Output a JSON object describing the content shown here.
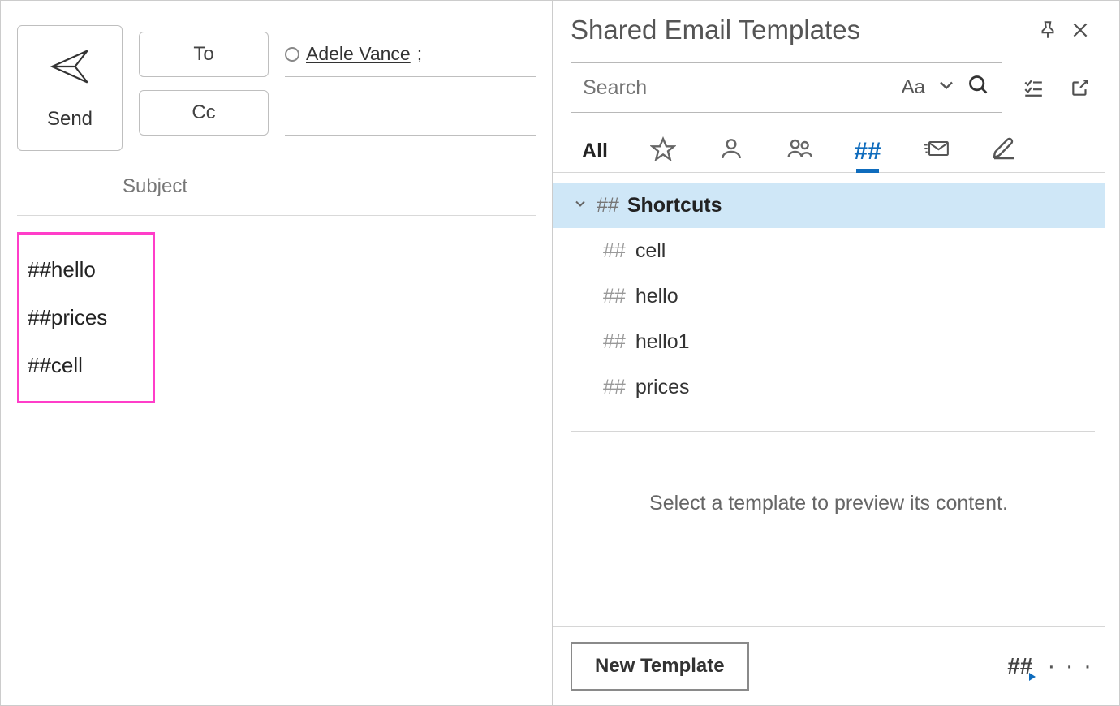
{
  "compose": {
    "send_label": "Send",
    "to_label": "To",
    "cc_label": "Cc",
    "subject_label": "Subject",
    "recipient": "Adele Vance",
    "recipient_suffix": ";",
    "body_shortcuts": [
      "##hello",
      "##prices",
      "##cell"
    ]
  },
  "templates": {
    "title": "Shared Email Templates",
    "search_placeholder": "Search",
    "case_label": "Aa",
    "tabs": {
      "all": "All",
      "shortcuts_glyph": "##",
      "active": "shortcuts"
    },
    "group": {
      "prefix": "##",
      "name": "Shortcuts"
    },
    "items": [
      {
        "prefix": "##",
        "name": "cell"
      },
      {
        "prefix": "##",
        "name": "hello"
      },
      {
        "prefix": "##",
        "name": "hello1"
      },
      {
        "prefix": "##",
        "name": "prices"
      }
    ],
    "preview_message": "Select a template to preview its content.",
    "new_template_label": "New Template",
    "footer_shortcut_glyph": "##",
    "more_glyph": "· · ·"
  }
}
